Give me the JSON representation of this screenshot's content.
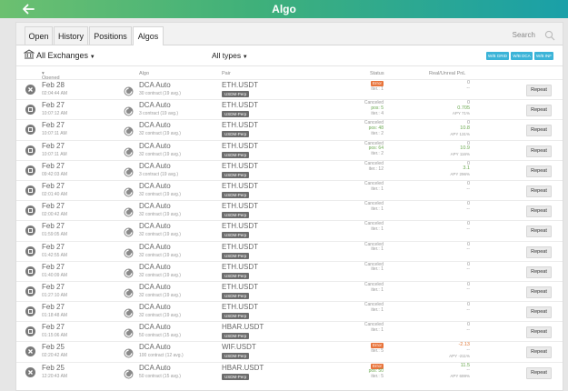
{
  "header": {
    "title": "Algo"
  },
  "tabs": [
    "Open",
    "History",
    "Positions",
    "Algos"
  ],
  "search": {
    "label": "Search"
  },
  "filters": {
    "exchanges": "All Exchanges",
    "types": "All types"
  },
  "pills": [
    "W/B GRID",
    "W/B DCA",
    "W/B INF"
  ],
  "columns": {
    "opened": "Opened",
    "algo": "Algo",
    "pair": "Pair",
    "status": "Status",
    "pnl": "Real/Unreal PnL"
  },
  "repeat_label": "Repeat",
  "rows": [
    {
      "date": "Feb 28",
      "time": "02:04:44 AM",
      "icon": "close",
      "algo": "DCA Auto",
      "sub": "30 contract (19 avg.)",
      "pair": "ETH.USDT",
      "tag": "USDM-Perp",
      "status": "Error",
      "pos": "",
      "iter": "iter.: 1",
      "pnl": "0",
      "pnl_color": "",
      "pnl2": "--",
      "apy": ""
    },
    {
      "date": "Feb 27",
      "time": "10:07:12 AM",
      "icon": "stop",
      "algo": "DCA Auto",
      "sub": "3 contract (19 avg.)",
      "pair": "ETH.USDT",
      "tag": "USDM-Perp",
      "status": "Canceled",
      "pos": "pos: 5",
      "iter": "iter.: 4",
      "pnl": "0",
      "pnl_color": "",
      "pnl2": "0.705",
      "apy": "APY 71%"
    },
    {
      "date": "Feb 27",
      "time": "10:07:11 AM",
      "icon": "stop",
      "algo": "DCA Auto",
      "sub": "32 contract (19 avg.)",
      "pair": "ETH.USDT",
      "tag": "USDM-Perp",
      "status": "Canceled",
      "pos": "pos: 48",
      "iter": "iter.: 2",
      "pnl": "0",
      "pnl_color": "",
      "pnl2": "10.8",
      "apy": "APY 131%"
    },
    {
      "date": "Feb 27",
      "time": "10:07:11 AM",
      "icon": "stop",
      "algo": "DCA Auto",
      "sub": "32 contract (19 avg.)",
      "pair": "ETH.USDT",
      "tag": "USDM-Perp",
      "status": "Canceled",
      "pos": "pos: 64",
      "iter": "iter.: 2",
      "pnl": "0",
      "pnl_color": "",
      "pnl2": "10.9",
      "apy": "APY 116%"
    },
    {
      "date": "Feb 27",
      "time": "09:42:03 AM",
      "icon": "stop",
      "algo": "DCA Auto",
      "sub": "3 contract (19 avg.)",
      "pair": "ETH.USDT",
      "tag": "USDM-Perp",
      "status": "Canceled",
      "pos": "",
      "iter": "iter.: 12",
      "pnl": "0",
      "pnl_color": "",
      "pnl2": "3.1",
      "apy": "APY 296%"
    },
    {
      "date": "Feb 27",
      "time": "02:01:40 AM",
      "icon": "stop",
      "algo": "DCA Auto",
      "sub": "32 contract (19 avg.)",
      "pair": "ETH.USDT",
      "tag": "USDM-Perp",
      "status": "Canceled",
      "pos": "",
      "iter": "iter.: 1",
      "pnl": "0",
      "pnl_color": "",
      "pnl2": "--",
      "apy": ""
    },
    {
      "date": "Feb 27",
      "time": "02:00:42 AM",
      "icon": "stop",
      "algo": "DCA Auto",
      "sub": "32 contract (19 avg.)",
      "pair": "ETH.USDT",
      "tag": "USDM-Perp",
      "status": "Canceled",
      "pos": "",
      "iter": "iter.: 1",
      "pnl": "0",
      "pnl_color": "",
      "pnl2": "--",
      "apy": ""
    },
    {
      "date": "Feb 27",
      "time": "01:59:05 AM",
      "icon": "stop",
      "algo": "DCA Auto",
      "sub": "32 contract (19 avg.)",
      "pair": "ETH.USDT",
      "tag": "USDM-Perp",
      "status": "Canceled",
      "pos": "",
      "iter": "iter.: 1",
      "pnl": "0",
      "pnl_color": "",
      "pnl2": "--",
      "apy": ""
    },
    {
      "date": "Feb 27",
      "time": "01:42:55 AM",
      "icon": "stop",
      "algo": "DCA Auto",
      "sub": "32 contract (19 avg.)",
      "pair": "ETH.USDT",
      "tag": "USDM-Perp",
      "status": "Canceled",
      "pos": "",
      "iter": "iter.: 1",
      "pnl": "0",
      "pnl_color": "",
      "pnl2": "--",
      "apy": ""
    },
    {
      "date": "Feb 27",
      "time": "01:40:09 AM",
      "icon": "stop",
      "algo": "DCA Auto",
      "sub": "32 contract (19 avg.)",
      "pair": "ETH.USDT",
      "tag": "USDM-Perp",
      "status": "Canceled",
      "pos": "",
      "iter": "iter.: 1",
      "pnl": "0",
      "pnl_color": "",
      "pnl2": "--",
      "apy": ""
    },
    {
      "date": "Feb 27",
      "time": "01:27:10 AM",
      "icon": "stop",
      "algo": "DCA Auto",
      "sub": "32 contract (19 avg.)",
      "pair": "ETH.USDT",
      "tag": "USDM-Perp",
      "status": "Canceled",
      "pos": "",
      "iter": "iter.: 1",
      "pnl": "0",
      "pnl_color": "",
      "pnl2": "--",
      "apy": ""
    },
    {
      "date": "Feb 27",
      "time": "01:18:48 AM",
      "icon": "stop",
      "algo": "DCA Auto",
      "sub": "32 contract (19 avg.)",
      "pair": "ETH.USDT",
      "tag": "USDM-Perp",
      "status": "Canceled",
      "pos": "",
      "iter": "iter.: 1",
      "pnl": "0",
      "pnl_color": "",
      "pnl2": "--",
      "apy": ""
    },
    {
      "date": "Feb 27",
      "time": "01:15:06 AM",
      "icon": "stop",
      "algo": "DCA Auto",
      "sub": "50 contract (15 avg.)",
      "pair": "HBAR.USDT",
      "tag": "USDM-Perp",
      "status": "Canceled",
      "pos": "",
      "iter": "iter.: 1",
      "pnl": "0",
      "pnl_color": "",
      "pnl2": "--",
      "apy": ""
    },
    {
      "date": "Feb 25",
      "time": "02:20:42 AM",
      "icon": "close",
      "algo": "DCA Auto",
      "sub": "100 contract (12 avg.)",
      "pair": "WIF.USDT",
      "tag": "USDM-Perp",
      "status": "Error",
      "pos": "",
      "iter": "iter.: 5",
      "pnl": "-2.13",
      "pnl_color": "red",
      "pnl2": "--",
      "apy": "APY -211%"
    },
    {
      "date": "Feb 25",
      "time": "12:20:43 AM",
      "icon": "close",
      "algo": "DCA Auto",
      "sub": "50 contract (15 avg.)",
      "pair": "HBAR.USDT",
      "tag": "USDM-Perp",
      "status": "Error",
      "pos": "pos: 50",
      "iter": "iter.: 5",
      "pnl": "11.5",
      "pnl_color": "green",
      "pnl2": "--",
      "apy": "APY 699%"
    }
  ]
}
